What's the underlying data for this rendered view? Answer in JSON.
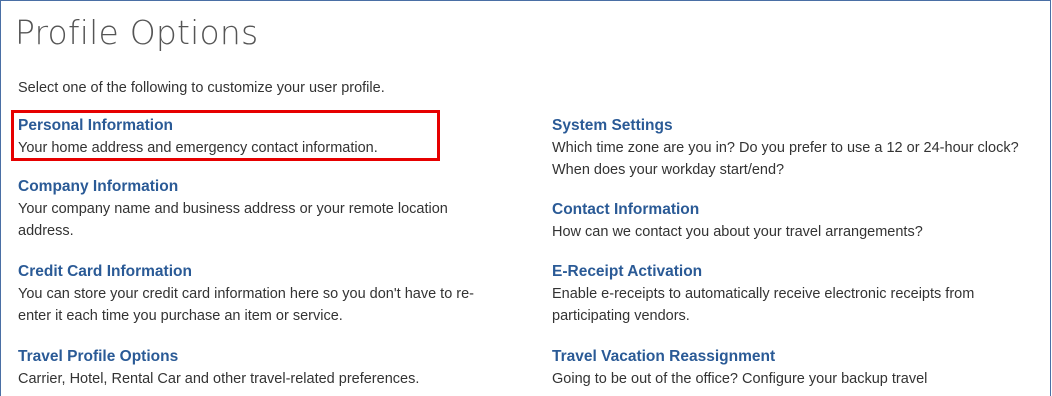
{
  "page": {
    "title": "Profile Options",
    "intro": "Select one of the following to customize your user profile."
  },
  "left_options": [
    {
      "title": "Personal Information",
      "desc": "Your home address and emergency contact information."
    },
    {
      "title": "Company Information",
      "desc": "Your company name and business address or your remote location address."
    },
    {
      "title": "Credit Card Information",
      "desc": "You can store your credit card information here so you don't have to re-enter it each time you purchase an item or service."
    },
    {
      "title": "Travel Profile Options",
      "desc": "Carrier, Hotel, Rental Car and other travel-related preferences."
    }
  ],
  "right_options": [
    {
      "title": "System Settings",
      "desc": "Which time zone are you in? Do you prefer to use a 12 or 24-hour clock? When does your workday start/end?"
    },
    {
      "title": "Contact Information",
      "desc": "How can we contact you about your travel arrangements?"
    },
    {
      "title": "E-Receipt Activation",
      "desc": "Enable e-receipts to automatically receive electronic receipts from participating vendors."
    },
    {
      "title": "Travel Vacation Reassignment",
      "desc": "Going to be out of the office? Configure your backup travel"
    }
  ],
  "colors": {
    "link": "#2a5a96",
    "text": "#333333",
    "title": "#555555",
    "highlight": "#e60000"
  }
}
